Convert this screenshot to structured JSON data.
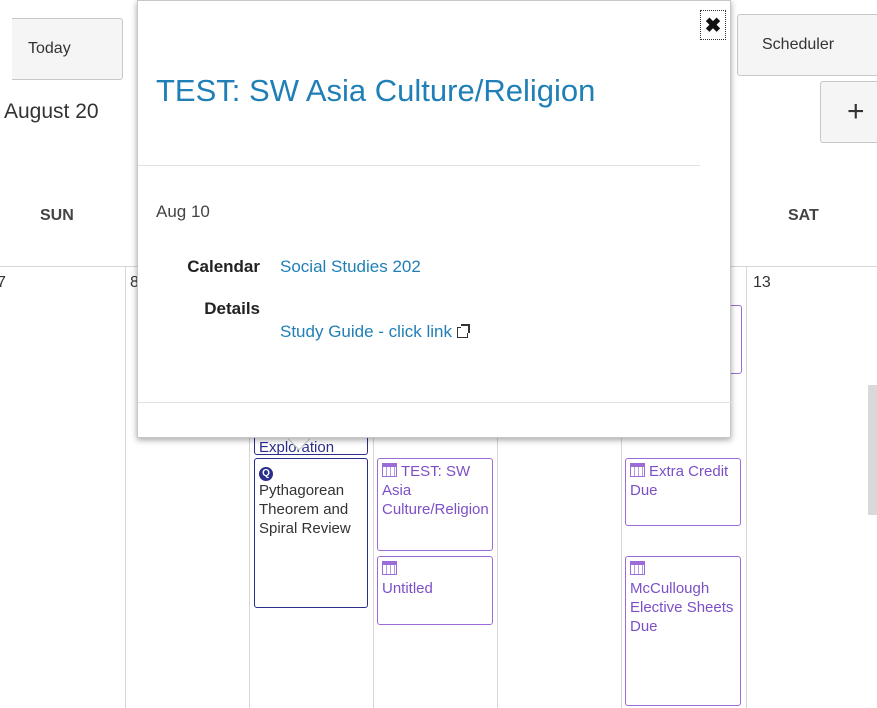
{
  "toolbar": {
    "today_label": "Today",
    "scheduler_label": "Scheduler",
    "add_label": "+"
  },
  "month_title": "August 20",
  "days_of_week": {
    "sun": "SUN",
    "sat": "SAT"
  },
  "day_numbers": {
    "d7": "7",
    "d8": "8",
    "d13": "13"
  },
  "events": {
    "exploration_partial": "Exploration",
    "quiz": {
      "icon": "Q",
      "title": "Pythagorean Theorem and Spiral Review"
    },
    "test": {
      "title": "TEST: SW Asia Culture/Religion"
    },
    "untitled": {
      "title": "Untitled"
    },
    "extra_credit": {
      "title": "Extra Credit Due"
    },
    "mccullough": {
      "title": "McCullough Elective Sheets Due"
    }
  },
  "popover": {
    "title": "TEST: SW Asia Culture/Religion",
    "date": "Aug 10",
    "calendar_label": "Calendar",
    "calendar_value": "Social Studies 202",
    "details_label": "Details",
    "details_link": "Study Guide - click link",
    "close_label": "✖"
  },
  "colors": {
    "link": "#1f7fb6",
    "event_border": "#9b6cd8",
    "quiz_border": "#2a2e8c"
  }
}
